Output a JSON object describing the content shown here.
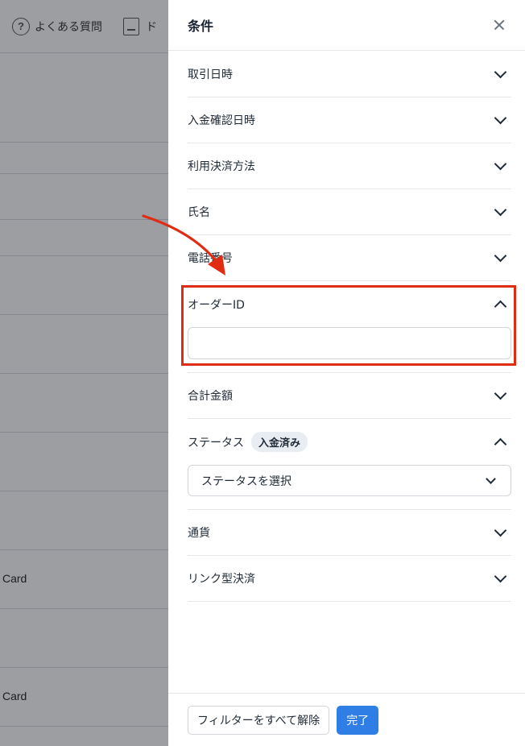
{
  "background": {
    "help_label": "よくある質問",
    "doc_label": "ド",
    "card_labels": [
      "Card",
      "Card"
    ]
  },
  "drawer": {
    "title": "条件",
    "filters": {
      "transaction_date": "取引日時",
      "payment_confirm_date": "入金確認日時",
      "payment_method": "利用決済方法",
      "name": "氏名",
      "phone": "電話番号",
      "order_id": "オーダーID",
      "order_id_value": "",
      "total_amount": "合計金額",
      "status": "ステータス",
      "status_badge": "入金済み",
      "status_select": "ステータスを選択",
      "currency": "通貨",
      "link_payment": "リンク型決済"
    },
    "footer": {
      "clear_label": "フィルターをすべて解除",
      "done_label": "完了"
    }
  },
  "colors": {
    "highlight": "#e12c14",
    "primary": "#2f7ee6"
  }
}
